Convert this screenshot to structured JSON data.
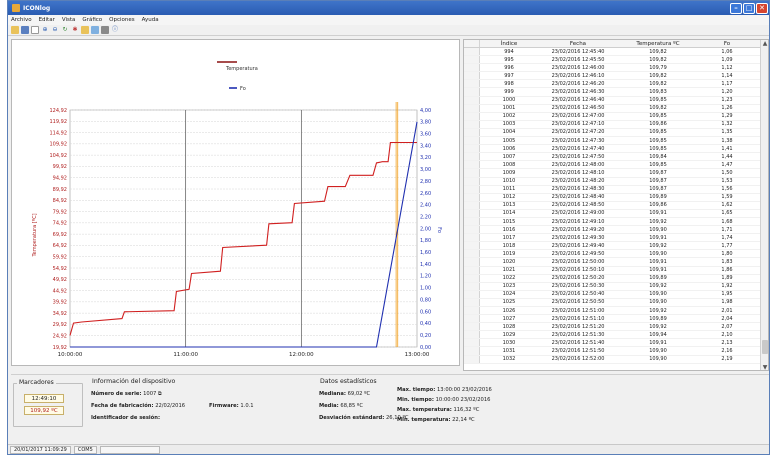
{
  "window": {
    "title": "ICONlog"
  },
  "menu": [
    "Archivo",
    "Editar",
    "Vista",
    "Gráfico",
    "Opciones",
    "Ayuda"
  ],
  "toolbar_icons": [
    "folder-icon",
    "save-icon",
    "new-page-icon",
    "zoom-in-icon",
    "zoom-out-icon",
    "refresh-icon",
    "settings-icon",
    "export-icon",
    "table-icon",
    "print-icon",
    "info-icon"
  ],
  "chart_data": {
    "type": "line",
    "x_ticks": [
      "10:00:00",
      "11:00:00",
      "12:00:00",
      "13:00:00"
    ],
    "x_range_hours": [
      10.0,
      13.0
    ],
    "y_left_ticks": [
      "124,92",
      "119,92",
      "114,92",
      "109,92",
      "104,92",
      "99,92",
      "94,92",
      "89,92",
      "84,92",
      "79,92",
      "74,92",
      "69,92",
      "64,92",
      "59,92",
      "54,92",
      "49,92",
      "44,92",
      "39,92",
      "34,92",
      "29,92",
      "24,92",
      "19,92"
    ],
    "y_left_label": "Temperatura [ºC]",
    "y_left_range": [
      19.92,
      124.92
    ],
    "y_right_ticks": [
      "4,00",
      "3,80",
      "3,60",
      "3,40",
      "3,20",
      "3,00",
      "2,80",
      "2,60",
      "2,40",
      "2,20",
      "2,00",
      "1,80",
      "1,60",
      "1,40",
      "1,20",
      "1,00",
      "0,80",
      "0,60",
      "0,40",
      "0,20",
      "0,00"
    ],
    "y_right_label": "Fo",
    "y_right_range": [
      0,
      4
    ],
    "series": [
      {
        "name": "Temperatura",
        "color": "#d02020",
        "axis": "left",
        "x": [
          10.0,
          10.03,
          10.1,
          10.45,
          10.47,
          10.9,
          10.92,
          11.03,
          11.05,
          11.3,
          11.32,
          11.7,
          11.72,
          11.92,
          11.94,
          12.2,
          12.23,
          12.38,
          12.42,
          12.62,
          12.65,
          12.7,
          12.75,
          12.77,
          13.0
        ],
        "y": [
          25.0,
          30.5,
          31.0,
          32.5,
          35.5,
          36.0,
          44.5,
          45.5,
          52.5,
          53.5,
          64.0,
          65.0,
          74.5,
          75.0,
          83.5,
          84.5,
          91.0,
          91.0,
          96.0,
          96.0,
          101.5,
          102.0,
          102.0,
          110.5,
          110.5
        ]
      },
      {
        "name": "Fo",
        "color": "#2030b0",
        "axis": "right",
        "x": [
          10.0,
          12.62,
          12.65,
          13.0
        ],
        "y": [
          0.0,
          0.0,
          0.0,
          3.8
        ]
      }
    ],
    "marker_lines": [
      "12:49:10",
      "12:50:00"
    ],
    "grid": true,
    "legend": "top-left"
  },
  "table": {
    "headers": [
      "Índice",
      "Fecha",
      "Temperatura ºC",
      "Fo"
    ],
    "rows": [
      [
        "994",
        "23/02/2016 12:45:40",
        "109,82",
        "1,06"
      ],
      [
        "995",
        "23/02/2016 12:45:50",
        "109,82",
        "1,09"
      ],
      [
        "996",
        "23/02/2016 12:46:00",
        "109,79",
        "1,12"
      ],
      [
        "997",
        "23/02/2016 12:46:10",
        "109,82",
        "1,14"
      ],
      [
        "998",
        "23/02/2016 12:46:20",
        "109,82",
        "1,17"
      ],
      [
        "999",
        "23/02/2016 12:46:30",
        "109,83",
        "1,20"
      ],
      [
        "1000",
        "23/02/2016 12:46:40",
        "109,85",
        "1,23"
      ],
      [
        "1001",
        "23/02/2016 12:46:50",
        "109,82",
        "1,26"
      ],
      [
        "1002",
        "23/02/2016 12:47:00",
        "109,85",
        "1,29"
      ],
      [
        "1003",
        "23/02/2016 12:47:10",
        "109,86",
        "1,32"
      ],
      [
        "1004",
        "23/02/2016 12:47:20",
        "109,85",
        "1,35"
      ],
      [
        "1005",
        "23/02/2016 12:47:30",
        "109,85",
        "1,38"
      ],
      [
        "1006",
        "23/02/2016 12:47:40",
        "109,85",
        "1,41"
      ],
      [
        "1007",
        "23/02/2016 12:47:50",
        "109,84",
        "1,44"
      ],
      [
        "1008",
        "23/02/2016 12:48:00",
        "109,85",
        "1,47"
      ],
      [
        "1009",
        "23/02/2016 12:48:10",
        "109,87",
        "1,50"
      ],
      [
        "1010",
        "23/02/2016 12:48:20",
        "109,87",
        "1,53"
      ],
      [
        "1011",
        "23/02/2016 12:48:30",
        "109,87",
        "1,56"
      ],
      [
        "1012",
        "23/02/2016 12:48:40",
        "109,89",
        "1,59"
      ],
      [
        "1013",
        "23/02/2016 12:48:50",
        "109,86",
        "1,62"
      ],
      [
        "1014",
        "23/02/2016 12:49:00",
        "109,91",
        "1,65"
      ],
      [
        "1015",
        "23/02/2016 12:49:10",
        "109,92",
        "1,68"
      ],
      [
        "1016",
        "23/02/2016 12:49:20",
        "109,90",
        "1,71"
      ],
      [
        "1017",
        "23/02/2016 12:49:30",
        "109,91",
        "1,74"
      ],
      [
        "1018",
        "23/02/2016 12:49:40",
        "109,92",
        "1,77"
      ],
      [
        "1019",
        "23/02/2016 12:49:50",
        "109,90",
        "1,80"
      ],
      [
        "1020",
        "23/02/2016 12:50:00",
        "109,91",
        "1,83"
      ],
      [
        "1021",
        "23/02/2016 12:50:10",
        "109,91",
        "1,86"
      ],
      [
        "1022",
        "23/02/2016 12:50:20",
        "109,89",
        "1,89"
      ],
      [
        "1023",
        "23/02/2016 12:50:30",
        "109,92",
        "1,92"
      ],
      [
        "1024",
        "23/02/2016 12:50:40",
        "109,90",
        "1,95"
      ],
      [
        "1025",
        "23/02/2016 12:50:50",
        "109,90",
        "1,98"
      ],
      [
        "1026",
        "23/02/2016 12:51:00",
        "109,92",
        "2,01"
      ],
      [
        "1027",
        "23/02/2016 12:51:10",
        "109,89",
        "2,04"
      ],
      [
        "1028",
        "23/02/2016 12:51:20",
        "109,92",
        "2,07"
      ],
      [
        "1029",
        "23/02/2016 12:51:30",
        "109,94",
        "2,10"
      ],
      [
        "1030",
        "23/02/2016 12:51:40",
        "109,91",
        "2,13"
      ],
      [
        "1031",
        "23/02/2016 12:51:50",
        "109,90",
        "2,16"
      ],
      [
        "1032",
        "23/02/2016 12:52:00",
        "109,90",
        "2,19"
      ]
    ]
  },
  "markers": {
    "title": "Marcadores",
    "time": "12:49:10",
    "temp": "109,92 ºC"
  },
  "device": {
    "title": "Información del dispositivo",
    "serial_label": "Número de serie:",
    "serial_value": "1007",
    "fab_label": "Fecha de fabricación:",
    "fab_value": "22/02/2016",
    "firmware_label": "Firmware:",
    "firmware_value": "1.0.1",
    "session_label": "Identificador de sesión:"
  },
  "stats": {
    "title": "Datos estadísticos",
    "median_label": "Mediana:",
    "median_value": "69,02 ºC",
    "mean_label": "Media:",
    "mean_value": "68,85 ºC",
    "std_label": "Desviación estándard:",
    "std_value": "26,10 ºC",
    "max_time_label": "Max. tiempo:",
    "max_time_value": "13:00:00 23/02/2016",
    "min_time_label": "Min. tiempo:",
    "min_time_value": "10:00:00 23/02/2016",
    "max_temp_label": "Max. temperatura:",
    "max_temp_value": "116,32 ºC",
    "min_temp_label": "Min. temperatura:",
    "min_temp_value": "22,14 ºC"
  },
  "statusbar": {
    "datetime": "20/01/2017 11:09:29",
    "port": "COM5"
  }
}
